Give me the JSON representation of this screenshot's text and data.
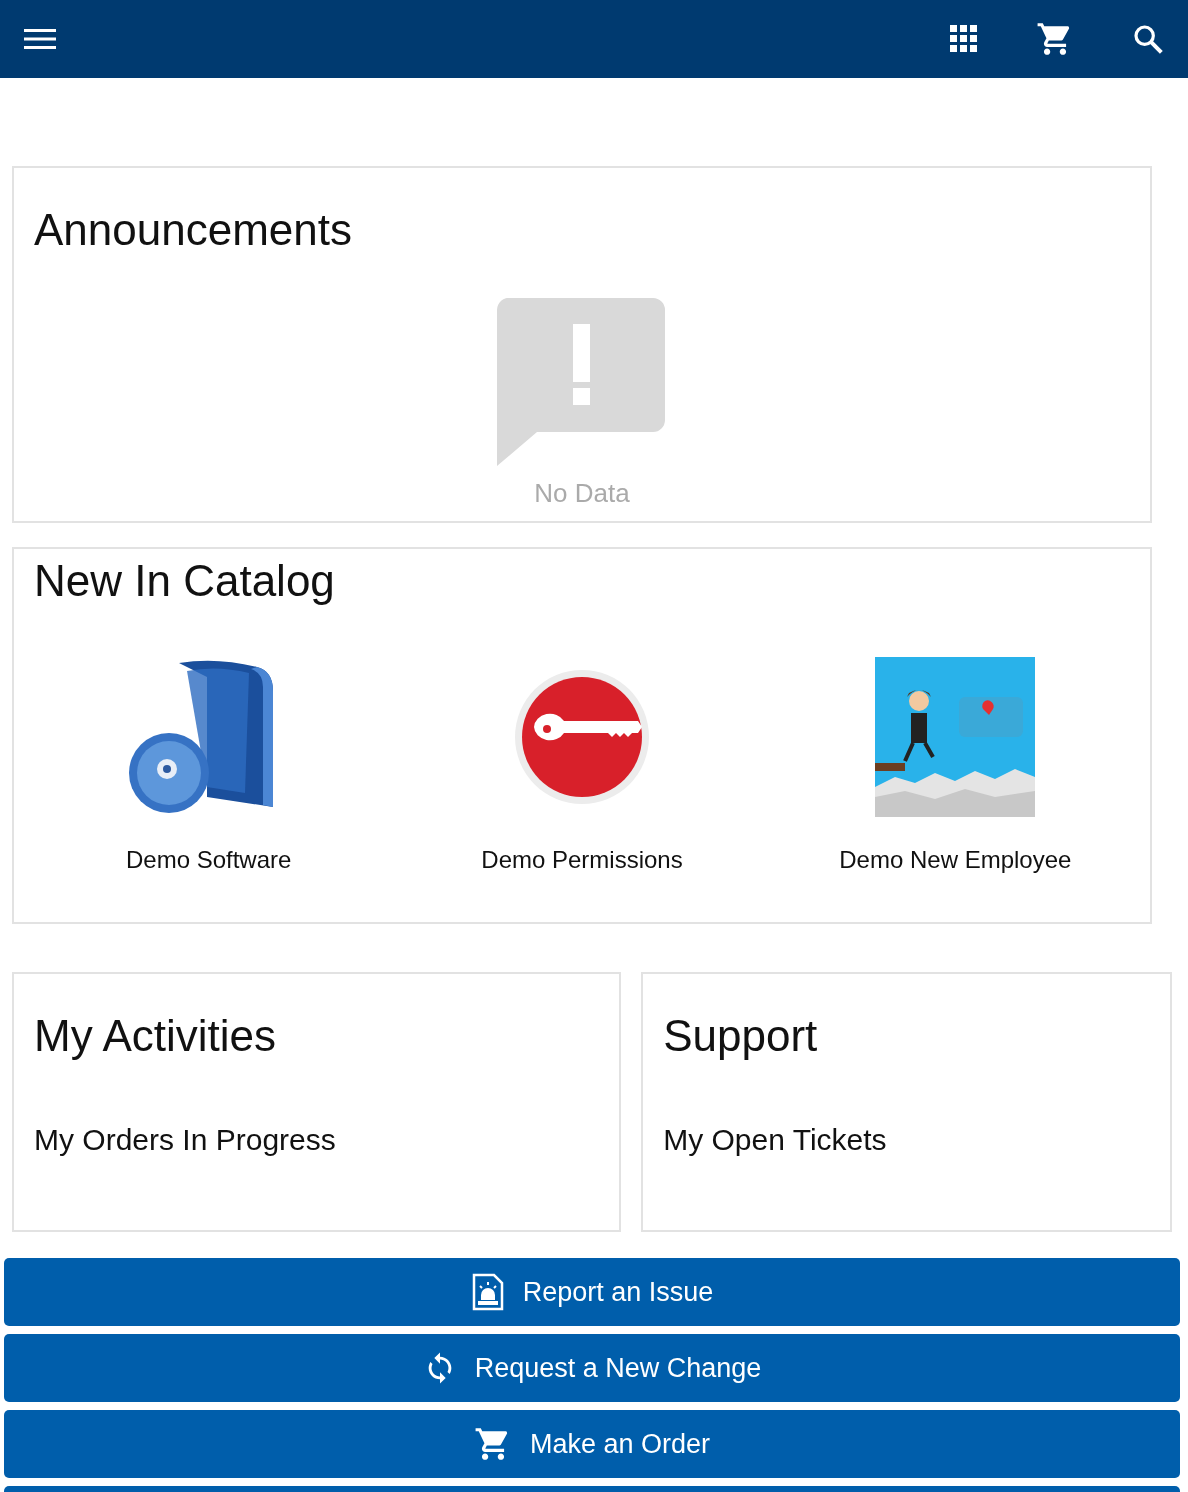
{
  "navbar": {
    "actions": [
      {
        "kind": "apps"
      },
      {
        "kind": "cart"
      },
      {
        "kind": "search"
      }
    ]
  },
  "announcements": {
    "title": "Announcements",
    "empty_text": "No Data"
  },
  "catalog": {
    "title": "New In Catalog",
    "items": [
      {
        "kind": "software",
        "label": "Demo Software"
      },
      {
        "kind": "key",
        "label": "Demo Permissions"
      },
      {
        "kind": "picture",
        "label": "Demo New Employee"
      }
    ]
  },
  "panels": [
    {
      "title": "My Activities",
      "item": "My Orders In Progress"
    },
    {
      "title": "Support",
      "item": "My Open Tickets"
    }
  ],
  "actions": [
    {
      "kind": "report",
      "label": "Report an Issue"
    },
    {
      "kind": "change",
      "label": "Request a New Change"
    },
    {
      "kind": "order",
      "label": "Make an Order"
    },
    {
      "kind": "more"
    }
  ]
}
